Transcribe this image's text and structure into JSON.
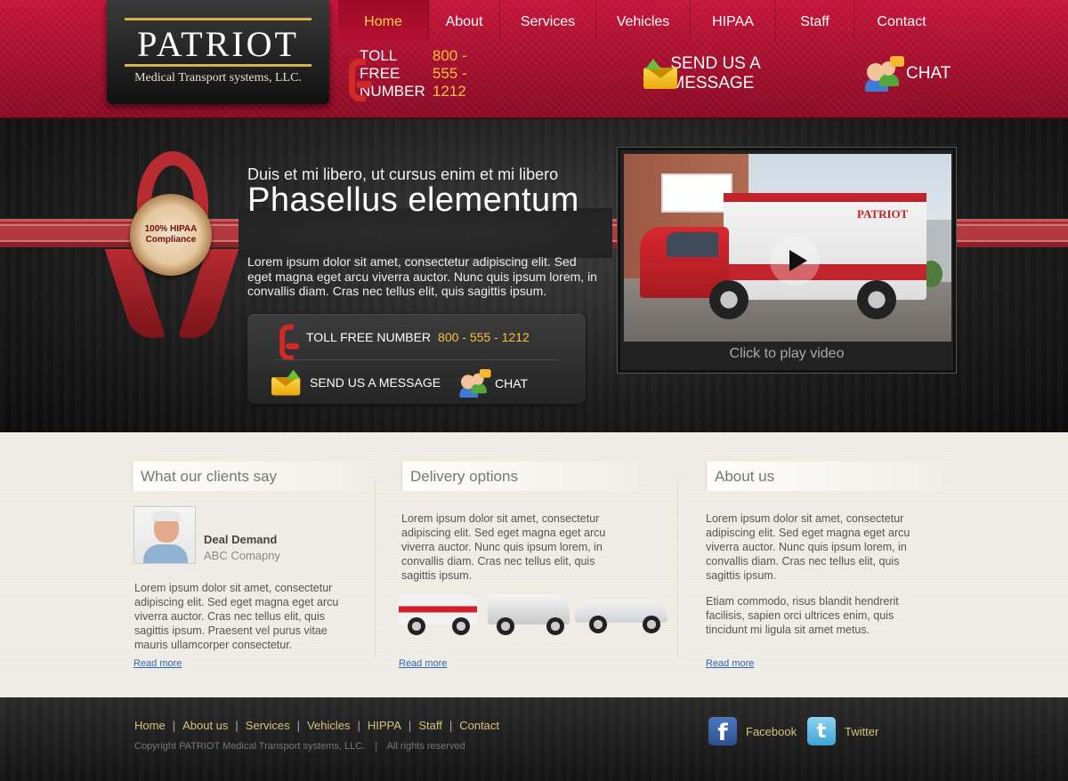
{
  "logo": {
    "title": "PATRIOT",
    "subtitle": "Medical Transport systems, LLC."
  },
  "nav": {
    "items": [
      {
        "label": "Home",
        "active": true
      },
      {
        "label": "About",
        "active": false
      },
      {
        "label": "Services",
        "active": false
      },
      {
        "label": "Vehicles",
        "active": false
      },
      {
        "label": "HIPAA",
        "active": false
      },
      {
        "label": "Staff",
        "active": false
      },
      {
        "label": "Contact",
        "active": false
      }
    ]
  },
  "header_contact": {
    "toll_free_label": "TOLL FREE NUMBER",
    "toll_free_number": "800 - 555 - 1212",
    "message_label": "SEND US A MESSAGE",
    "chat_label": "CHAT"
  },
  "hero": {
    "seal": "100% HIPAA Compliance",
    "subtitle": "Duis et mi libero, ut cursus enim et mi libero",
    "title": "Phasellus elementum",
    "text": "Lorem ipsum dolor sit amet, consectetur adipiscing elit. Sed eget magna eget arcu viverra auctor. Nunc quis ipsum lorem, in convallis diam. Cras nec tellus elit, quis sagittis ipsum.",
    "box": {
      "toll_free_label": "TOLL FREE NUMBER",
      "toll_free_number": "800 - 555 - 1212",
      "message_label": "SEND US A MESSAGE",
      "chat_label": "CHAT"
    },
    "video": {
      "caption": "Click to play video",
      "vehicle_text": "PATRIOT"
    }
  },
  "columns": {
    "clients": {
      "heading": "What our clients say",
      "name": "Deal Demand",
      "company": "ABC Comapny",
      "text": "Lorem ipsum dolor sit amet, consectetur adipiscing elit. Sed eget magna eget arcu viverra auctor. Cras nec tellus elit, quis sagittis ipsum. Praesent vel purus vitae mauris ullamcorper consectetur.",
      "read_more": "Read more"
    },
    "delivery": {
      "heading": "Delivery options",
      "text": "Lorem ipsum dolor sit amet, consectetur adipiscing elit. Sed eget magna eget arcu viverra auctor. Nunc quis ipsum lorem, in convallis diam. Cras nec tellus elit, quis sagittis ipsum.",
      "read_more": "Read more"
    },
    "about": {
      "heading": "About us",
      "text1": "Lorem ipsum dolor sit amet, consectetur adipiscing elit. Sed eget magna eget arcu viverra auctor. Nunc quis ipsum lorem, in convallis diam. Cras nec tellus elit, quis sagittis ipsum.",
      "text2": "Etiam commodo, risus blandit hendrerit facilisis, sapien orci ultrices enim, quis tincidunt mi ligula sit amet metus.",
      "read_more": "Read more"
    }
  },
  "footer": {
    "links": [
      "Home",
      "About us",
      "Services",
      "Vehicles",
      "HIPPA",
      "Staff",
      "Contact"
    ],
    "copyright": "Copyright PATRIOT Medical Transport systems, LLC.",
    "rights": "All rights reserved",
    "facebook": "Facebook",
    "twitter": "Twitter",
    "facebook_glyph": "f",
    "twitter_glyph": "t"
  },
  "colors": {
    "brand_red": "#b0102e",
    "accent_gold": "#f5c23e",
    "link_blue": "#2d66b8"
  }
}
